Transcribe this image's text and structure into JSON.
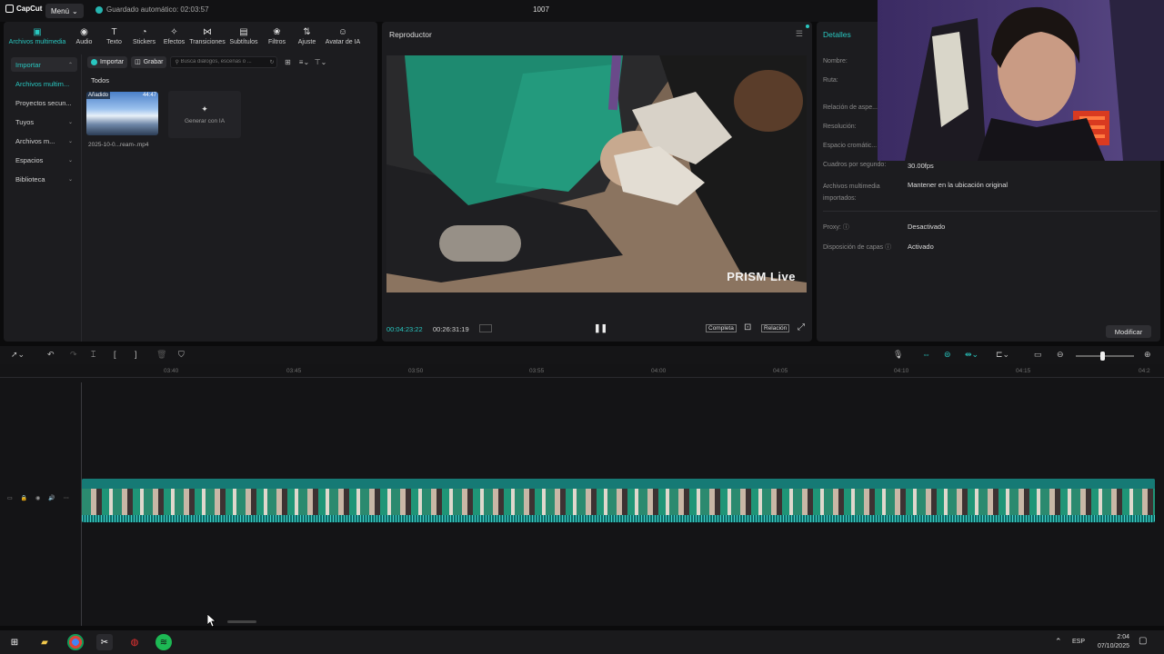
{
  "titlebar": {
    "app_name": "CapCut",
    "menu_label": "Menú",
    "autosave": "Guardado automático: 02:03:57",
    "project_name": "1007"
  },
  "media_tabs": [
    {
      "label": "Archivos multimedia",
      "icon": "media-icon"
    },
    {
      "label": "Audio",
      "icon": "audio-icon"
    },
    {
      "label": "Texto",
      "icon": "text-icon"
    },
    {
      "label": "Stickers",
      "icon": "sticker-icon"
    },
    {
      "label": "Efectos",
      "icon": "effects-icon"
    },
    {
      "label": "Transiciones",
      "icon": "transitions-icon"
    },
    {
      "label": "Subtítulos",
      "icon": "subtitles-icon"
    },
    {
      "label": "Filtros",
      "icon": "filters-icon"
    },
    {
      "label": "Ajuste",
      "icon": "adjust-icon"
    },
    {
      "label": "Avatar de IA",
      "icon": "ai-avatar-icon"
    }
  ],
  "media_side": [
    {
      "label": "Importar"
    },
    {
      "label": "Archivos multim..."
    },
    {
      "label": "Proyectos secun..."
    },
    {
      "label": "Tuyos"
    },
    {
      "label": "Archivos m..."
    },
    {
      "label": "Espacios"
    },
    {
      "label": "Biblioteca"
    }
  ],
  "media_toolbar": {
    "import_label": "Importar",
    "record_label": "Grabar",
    "search_placeholder": "Busca diálogos, escenas o ..."
  },
  "media_grid": {
    "section_label": "Todos",
    "clip": {
      "badge": "Añadido",
      "duration": "44:47",
      "name": "2025-10-0...ream-.mp4"
    },
    "generate_label": "Generar con IA"
  },
  "player": {
    "title": "Reproductor",
    "current_time": "00:04:23:22",
    "total_time": "00:26:31:19",
    "watermark": "PRISM Live",
    "completa_label": "Completa",
    "relacion_label": "Relación"
  },
  "details": {
    "title": "Detalles",
    "rows": [
      {
        "label": "Nombre:",
        "value": ""
      },
      {
        "label": "Ruta:",
        "value": ""
      },
      {
        "label": "Relación de aspe...",
        "value": ""
      },
      {
        "label": "Resolución:",
        "value": ""
      },
      {
        "label": "Espacio cromátic...",
        "value": ""
      },
      {
        "label": "Cuadros por segundo:",
        "value": "30.00fps"
      },
      {
        "label": "Archivos multimedia importados:",
        "value": "Mantener en la ubicación original"
      },
      {
        "label": "Proxy: ⓘ",
        "value": "Desactivado"
      },
      {
        "label": "Disposición de capas ⓘ",
        "value": "Activado"
      }
    ],
    "modify_label": "Modificar"
  },
  "ruler_ticks": [
    "03:40",
    "03:45",
    "03:50",
    "03:55",
    "04:00",
    "04:05",
    "04:10",
    "04:15",
    "04:2"
  ],
  "taskbar": {
    "lang": "ESP",
    "time": "2:04",
    "date": "07/10/2025"
  },
  "colors": {
    "accent": "#29c7c0",
    "track": "#1b8b86",
    "panel": "#1c1c1f"
  }
}
